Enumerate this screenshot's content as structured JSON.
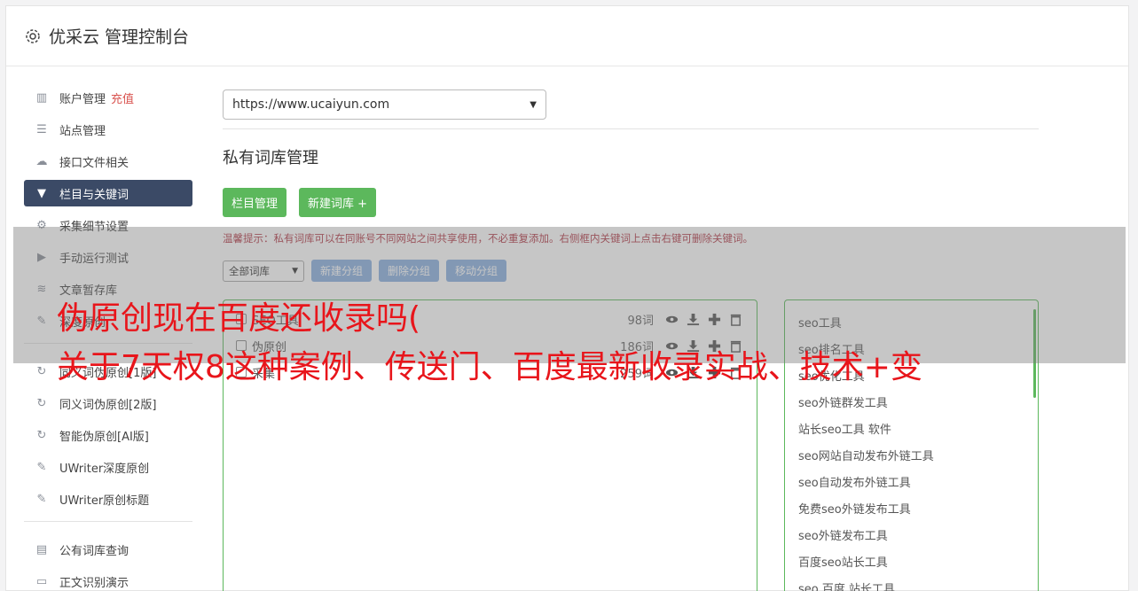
{
  "header": {
    "title": "优采云 管理控制台",
    "icon": "gear-icon"
  },
  "sidebar": {
    "items": [
      {
        "label": "账户管理",
        "icon": "bar-chart-icon",
        "extra": "充值"
      },
      {
        "label": "站点管理",
        "icon": "server-icon"
      },
      {
        "label": "接口文件相关",
        "icon": "cloud-upload-icon"
      },
      {
        "label": "栏目与关键词",
        "icon": "filter-icon",
        "active": true
      },
      {
        "label": "采集细节设置",
        "icon": "gears-icon"
      },
      {
        "label": "手动运行测试",
        "icon": "play-icon"
      },
      {
        "label": "文章暂存库",
        "icon": "database-icon"
      },
      {
        "label": "深度原创",
        "icon": "edit-icon"
      }
    ],
    "items2": [
      {
        "label": "同义词伪原创[1版]",
        "icon": "refresh-icon"
      },
      {
        "label": "同义词伪原创[2版]",
        "icon": "refresh-icon"
      },
      {
        "label": "智能伪原创[AI版]",
        "icon": "refresh-icon"
      },
      {
        "label": "UWriter深度原创",
        "icon": "edit-icon"
      },
      {
        "label": "UWriter原创标题",
        "icon": "edit-icon"
      }
    ],
    "items3": [
      {
        "label": "公有词库查询",
        "icon": "book-icon"
      },
      {
        "label": "正文识别演示",
        "icon": "monitor-icon"
      }
    ]
  },
  "main": {
    "site_select": "https://www.ucaiyun.com",
    "section_title": "私有词库管理",
    "btn_columns": "栏目管理",
    "btn_new_lib": "新建词库 +",
    "tip": "温馨提示：私有词库可以在同账号不同网站之间共享使用，不必重复添加。右侧框内关键词上点击右键可删除关键词。",
    "group_select": "全部词库",
    "btn_new_group": "新建分组",
    "btn_delete_group": "删除分组",
    "btn_move_group": "移动分组",
    "libraries": [
      {
        "name": "SEO工具",
        "count": "98词"
      },
      {
        "name": "伪原创",
        "count": "186词"
      },
      {
        "name": "采集",
        "count": "259词"
      }
    ],
    "keywords": [
      "seo工具",
      "seo排名工具",
      "seo优化工具",
      "seo外链群发工具",
      "站长seo工具 软件",
      "seo网站自动发布外链工具",
      "seo自动发布外链工具",
      "免费seo外链发布工具",
      "seo外链发布工具",
      "百度seo站长工具",
      "seo 百度 站长工具"
    ]
  },
  "overlay_title": {
    "line1": "伪原创现在百度还收录吗(",
    "line2": "关于7天权8这种案例、传送门、百度最新收录实战、技术+变"
  }
}
